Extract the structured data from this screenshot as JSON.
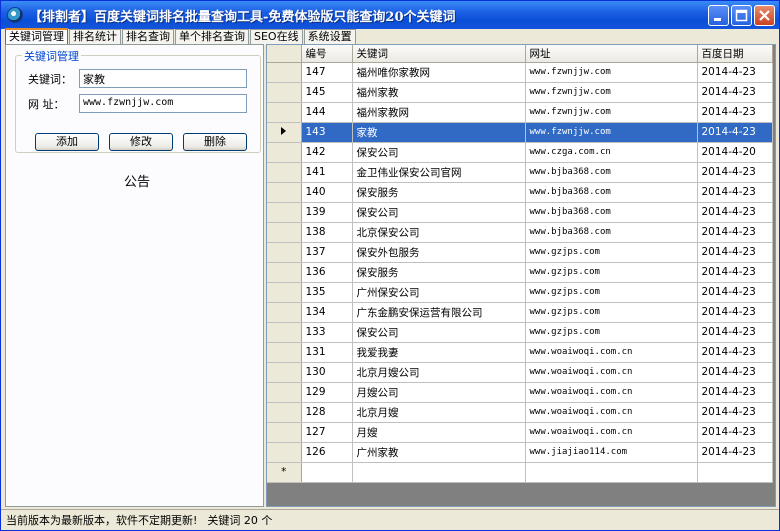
{
  "window": {
    "title": "【排割者】百度关键词排名批量查询工具-免费体验版只能查询20个关键词"
  },
  "tabs": [
    "关键词管理",
    "排名统计",
    "排名查询",
    "单个排名查询",
    "SEO在线",
    "系统设置"
  ],
  "keyword_panel": {
    "legend": "关键词管理",
    "keyword_label": "关键词：",
    "keyword_value": "家教",
    "url_label": "网  址：",
    "url_value": "www.fzwnjjw.com",
    "add_label": "添加",
    "edit_label": "修改",
    "delete_label": "删除"
  },
  "notice": {
    "title": "公告"
  },
  "table": {
    "columns": [
      "编号",
      "关键词",
      "网址",
      "百度日期"
    ],
    "selected_row": 3,
    "new_row_marker": "*",
    "rows": [
      [
        "147",
        "福州唯你家教网",
        "www.fzwnjjw.com",
        "2014-4-23"
      ],
      [
        "145",
        "福州家教",
        "www.fzwnjjw.com",
        "2014-4-23"
      ],
      [
        "144",
        "福州家教网",
        "www.fzwnjjw.com",
        "2014-4-23"
      ],
      [
        "143",
        "家教",
        "www.fzwnjjw.com",
        "2014-4-23"
      ],
      [
        "142",
        "保安公司",
        "www.czga.com.cn",
        "2014-4-20"
      ],
      [
        "141",
        "金卫伟业保安公司官网",
        "www.bjba368.com",
        "2014-4-23"
      ],
      [
        "140",
        "保安服务",
        "www.bjba368.com",
        "2014-4-23"
      ],
      [
        "139",
        "保安公司",
        "www.bjba368.com",
        "2014-4-23"
      ],
      [
        "138",
        "北京保安公司",
        "www.bjba368.com",
        "2014-4-23"
      ],
      [
        "137",
        "保安外包服务",
        "www.gzjps.com",
        "2014-4-23"
      ],
      [
        "136",
        "保安服务",
        "www.gzjps.com",
        "2014-4-23"
      ],
      [
        "135",
        "广州保安公司",
        "www.gzjps.com",
        "2014-4-23"
      ],
      [
        "134",
        "广东金鹏安保运营有限公司",
        "www.gzjps.com",
        "2014-4-23"
      ],
      [
        "133",
        "保安公司",
        "www.gzjps.com",
        "2014-4-23"
      ],
      [
        "131",
        "我爱我妻",
        "www.woaiwoqi.com.cn",
        "2014-4-23"
      ],
      [
        "130",
        "北京月嫂公司",
        "www.woaiwoqi.com.cn",
        "2014-4-23"
      ],
      [
        "129",
        "月嫂公司",
        "www.woaiwoqi.com.cn",
        "2014-4-23"
      ],
      [
        "128",
        "北京月嫂",
        "www.woaiwoqi.com.cn",
        "2014-4-23"
      ],
      [
        "127",
        "月嫂",
        "www.woaiwoqi.com.cn",
        "2014-4-23"
      ],
      [
        "126",
        "广州家教",
        "www.jiajiao114.com",
        "2014-4-23"
      ]
    ]
  },
  "status": {
    "message": "当前版本为最新版本，软件不定期更新!",
    "count": "关键词 20 个"
  }
}
